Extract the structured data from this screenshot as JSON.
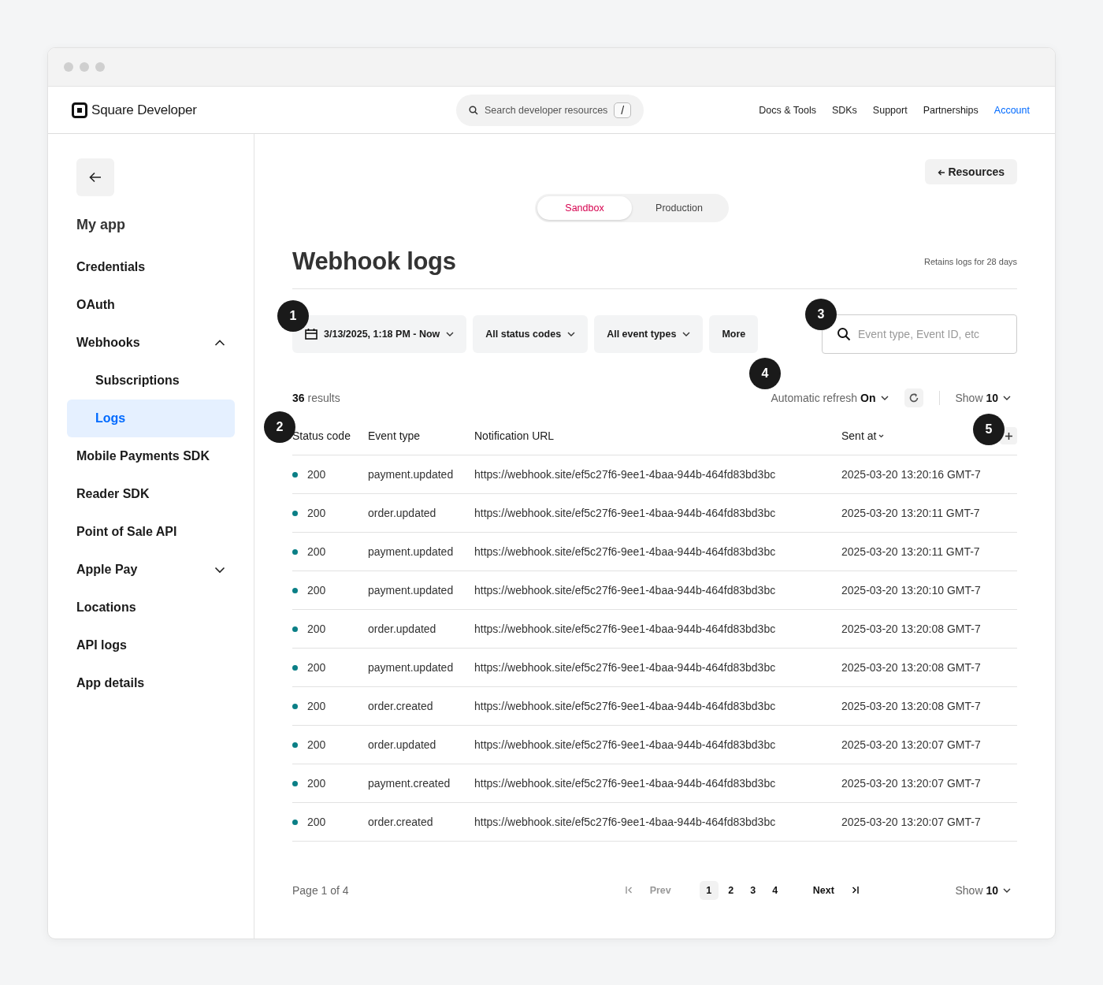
{
  "header": {
    "logo_text": "Square Developer",
    "search": {
      "placeholder": "Search developer resources",
      "shortcut": "/"
    },
    "nav": [
      {
        "label": "Docs & Tools",
        "selected": false
      },
      {
        "label": "SDKs",
        "selected": false
      },
      {
        "label": "Support",
        "selected": false
      },
      {
        "label": "Partnerships",
        "selected": false
      },
      {
        "label": "Account",
        "selected": true
      }
    ]
  },
  "sidebar": {
    "app_name": "My app",
    "items": [
      {
        "label": "Credentials",
        "selected": false
      },
      {
        "label": "OAuth",
        "selected": false
      },
      {
        "label": "Webhooks",
        "selected": false,
        "expanded": true,
        "children": [
          {
            "label": "Subscriptions",
            "selected": false
          },
          {
            "label": "Logs",
            "selected": true
          }
        ]
      },
      {
        "label": "Mobile Payments SDK",
        "selected": false
      },
      {
        "label": "Reader SDK",
        "selected": false
      },
      {
        "label": "Point of Sale API",
        "selected": false
      },
      {
        "label": "Apple Pay",
        "selected": false,
        "expanded": false
      },
      {
        "label": "Locations",
        "selected": false
      },
      {
        "label": "API logs",
        "selected": false
      },
      {
        "label": "App details",
        "selected": false
      }
    ]
  },
  "resources_button": "Resources",
  "environment_tabs": [
    {
      "label": "Sandbox",
      "selected": true
    },
    {
      "label": "Production",
      "selected": false
    }
  ],
  "title": "Webhook logs",
  "retention_note": "Retains logs for 28 days",
  "filters": [
    {
      "label": "3/13/2025, 1:18 PM - Now",
      "kind": "date"
    },
    {
      "label": "All status codes",
      "kind": "dropdown"
    },
    {
      "label": "All event types",
      "kind": "dropdown"
    },
    {
      "label": "More",
      "kind": "button"
    }
  ],
  "search": {
    "placeholder": "Event type, Event ID, etc"
  },
  "results": "**36** results",
  "auto_refresh": "Automatic refresh **On**",
  "show": "Show **10**",
  "table": {
    "columns": [
      "Status code",
      "Event type",
      "Notification URL",
      "Sent at"
    ],
    "rows": [
      {
        "status": "200",
        "event": "payment.updated",
        "url": "https://webhook.site/ef5c27f6-9ee1-4baa-944b-464fd83bd3bc",
        "sent": "2025-03-20 13:20:16 GMT-7"
      },
      {
        "status": "200",
        "event": "order.updated",
        "url": "https://webhook.site/ef5c27f6-9ee1-4baa-944b-464fd83bd3bc",
        "sent": "2025-03-20 13:20:11 GMT-7"
      },
      {
        "status": "200",
        "event": "payment.updated",
        "url": "https://webhook.site/ef5c27f6-9ee1-4baa-944b-464fd83bd3bc",
        "sent": "2025-03-20 13:20:11 GMT-7"
      },
      {
        "status": "200",
        "event": "payment.updated",
        "url": "https://webhook.site/ef5c27f6-9ee1-4baa-944b-464fd83bd3bc",
        "sent": "2025-03-20 13:20:10 GMT-7"
      },
      {
        "status": "200",
        "event": "order.updated",
        "url": "https://webhook.site/ef5c27f6-9ee1-4baa-944b-464fd83bd3bc",
        "sent": "2025-03-20 13:20:08 GMT-7"
      },
      {
        "status": "200",
        "event": "payment.updated",
        "url": "https://webhook.site/ef5c27f6-9ee1-4baa-944b-464fd83bd3bc",
        "sent": "2025-03-20 13:20:08 GMT-7"
      },
      {
        "status": "200",
        "event": "order.created",
        "url": "https://webhook.site/ef5c27f6-9ee1-4baa-944b-464fd83bd3bc",
        "sent": "2025-03-20 13:20:08 GMT-7"
      },
      {
        "status": "200",
        "event": "order.updated",
        "url": "https://webhook.site/ef5c27f6-9ee1-4baa-944b-464fd83bd3bc",
        "sent": "2025-03-20 13:20:07 GMT-7"
      },
      {
        "status": "200",
        "event": "payment.created",
        "url": "https://webhook.site/ef5c27f6-9ee1-4baa-944b-464fd83bd3bc",
        "sent": "2025-03-20 13:20:07 GMT-7"
      },
      {
        "status": "200",
        "event": "order.created",
        "url": "https://webhook.site/ef5c27f6-9ee1-4baa-944b-464fd83bd3bc",
        "sent": "2025-03-20 13:20:07 GMT-7"
      }
    ]
  },
  "pagination": {
    "page_label": "Page 1 of 4",
    "prev": {
      "label": "Prev",
      "disabled": true
    },
    "next": {
      "label": "Next",
      "disabled": false
    },
    "pages": [
      {
        "label": "1",
        "selected": true
      },
      {
        "label": "2",
        "selected": false
      },
      {
        "label": "3",
        "selected": false
      },
      {
        "label": "4",
        "selected": false
      }
    ],
    "show": "Show **10**"
  },
  "callouts": [
    "1",
    "2",
    "3",
    "4",
    "5"
  ]
}
